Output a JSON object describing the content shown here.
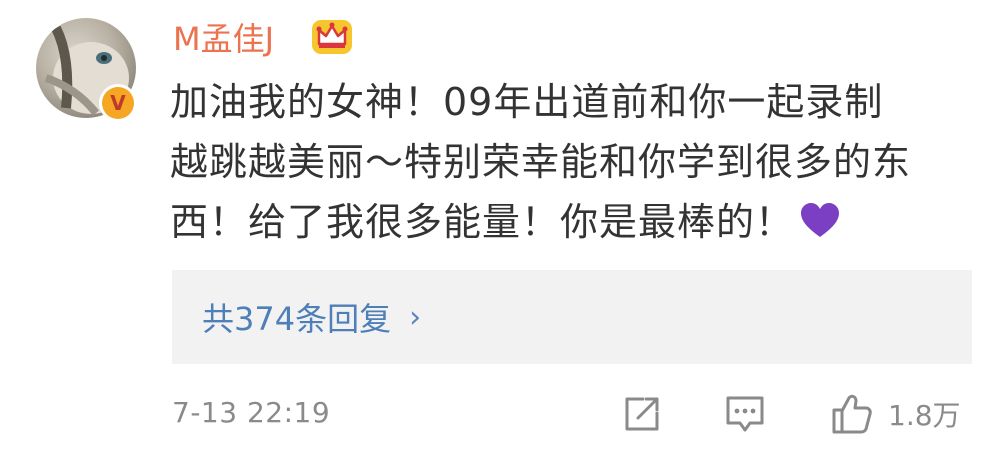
{
  "comment": {
    "username": "M孟佳J",
    "content_lines": [
      "加油我的女神！09年出道前和你一起录制",
      "越跳越美丽～特别荣幸能和你学到很多的东",
      "西！给了我很多能量！你是最棒的！"
    ],
    "replies_link": "共374条回复",
    "timestamp": "7-13 22:19",
    "like_count": "1.8万"
  },
  "icons": {
    "verified": "verified-v-badge",
    "crown": "crown-icon",
    "heart": "purple-heart-emoji",
    "share": "share-icon",
    "comment": "comment-icon",
    "like": "thumbs-up-icon"
  },
  "colors": {
    "username": "#eb7350",
    "link": "#4f7fb8",
    "meta": "#8a8a8a",
    "reply_box_bg": "#f2f2f2",
    "heart": "#7b3fc4",
    "badge": "#f5a623"
  }
}
